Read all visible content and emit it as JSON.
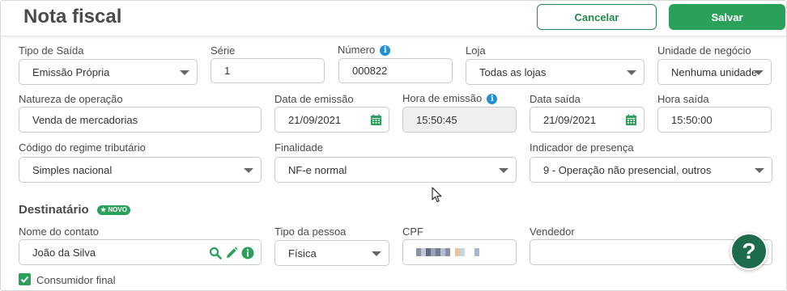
{
  "header": {
    "title": "Nota fiscal",
    "cancel_label": "Cancelar",
    "save_label": "Salvar"
  },
  "colors": {
    "brand_green": "#2ba05a",
    "info_blue": "#1e8fd8",
    "help_green": "#1c6b4a"
  },
  "row1": {
    "tipo_saida": {
      "label": "Tipo de Saída",
      "value": "Emissão Própria"
    },
    "serie": {
      "label": "Série",
      "value": "1"
    },
    "numero": {
      "label": "Número",
      "value": "000822",
      "info": "i"
    },
    "loja": {
      "label": "Loja",
      "value": "Todas as lojas"
    },
    "unidade": {
      "label": "Unidade de negócio",
      "value": "Nenhuma unidade"
    }
  },
  "row2": {
    "natureza": {
      "label": "Natureza de operação",
      "value": "Venda de mercadorias"
    },
    "data_emissao": {
      "label": "Data de emissão",
      "value": "21/09/2021"
    },
    "hora_emissao": {
      "label": "Hora de emissão",
      "value": "15:50:45",
      "info": "i"
    },
    "data_saida": {
      "label": "Data saída",
      "value": "21/09/2021"
    },
    "hora_saida": {
      "label": "Hora saída",
      "value": "15:50:00"
    }
  },
  "row3": {
    "regime": {
      "label": "Código do regime tributário",
      "value": "Simples nacional"
    },
    "finalidade": {
      "label": "Finalidade",
      "value": "NF-e normal"
    },
    "presenca": {
      "label": "Indicador de presença",
      "value": "9 - Operação não presencial, outros"
    }
  },
  "destinatario": {
    "title": "Destinatário",
    "badge": "★ NOVO",
    "contato": {
      "label": "Nome do contato",
      "value": "João da Silva"
    },
    "tipo_pessoa": {
      "label": "Tipo da pessoa",
      "value": "Física"
    },
    "cpf": {
      "label": "CPF"
    },
    "vendedor": {
      "label": "Vendedor",
      "value": ""
    },
    "consumidor_final": {
      "label": "Consumidor final",
      "checked": true
    }
  },
  "help": {
    "label": "?"
  }
}
